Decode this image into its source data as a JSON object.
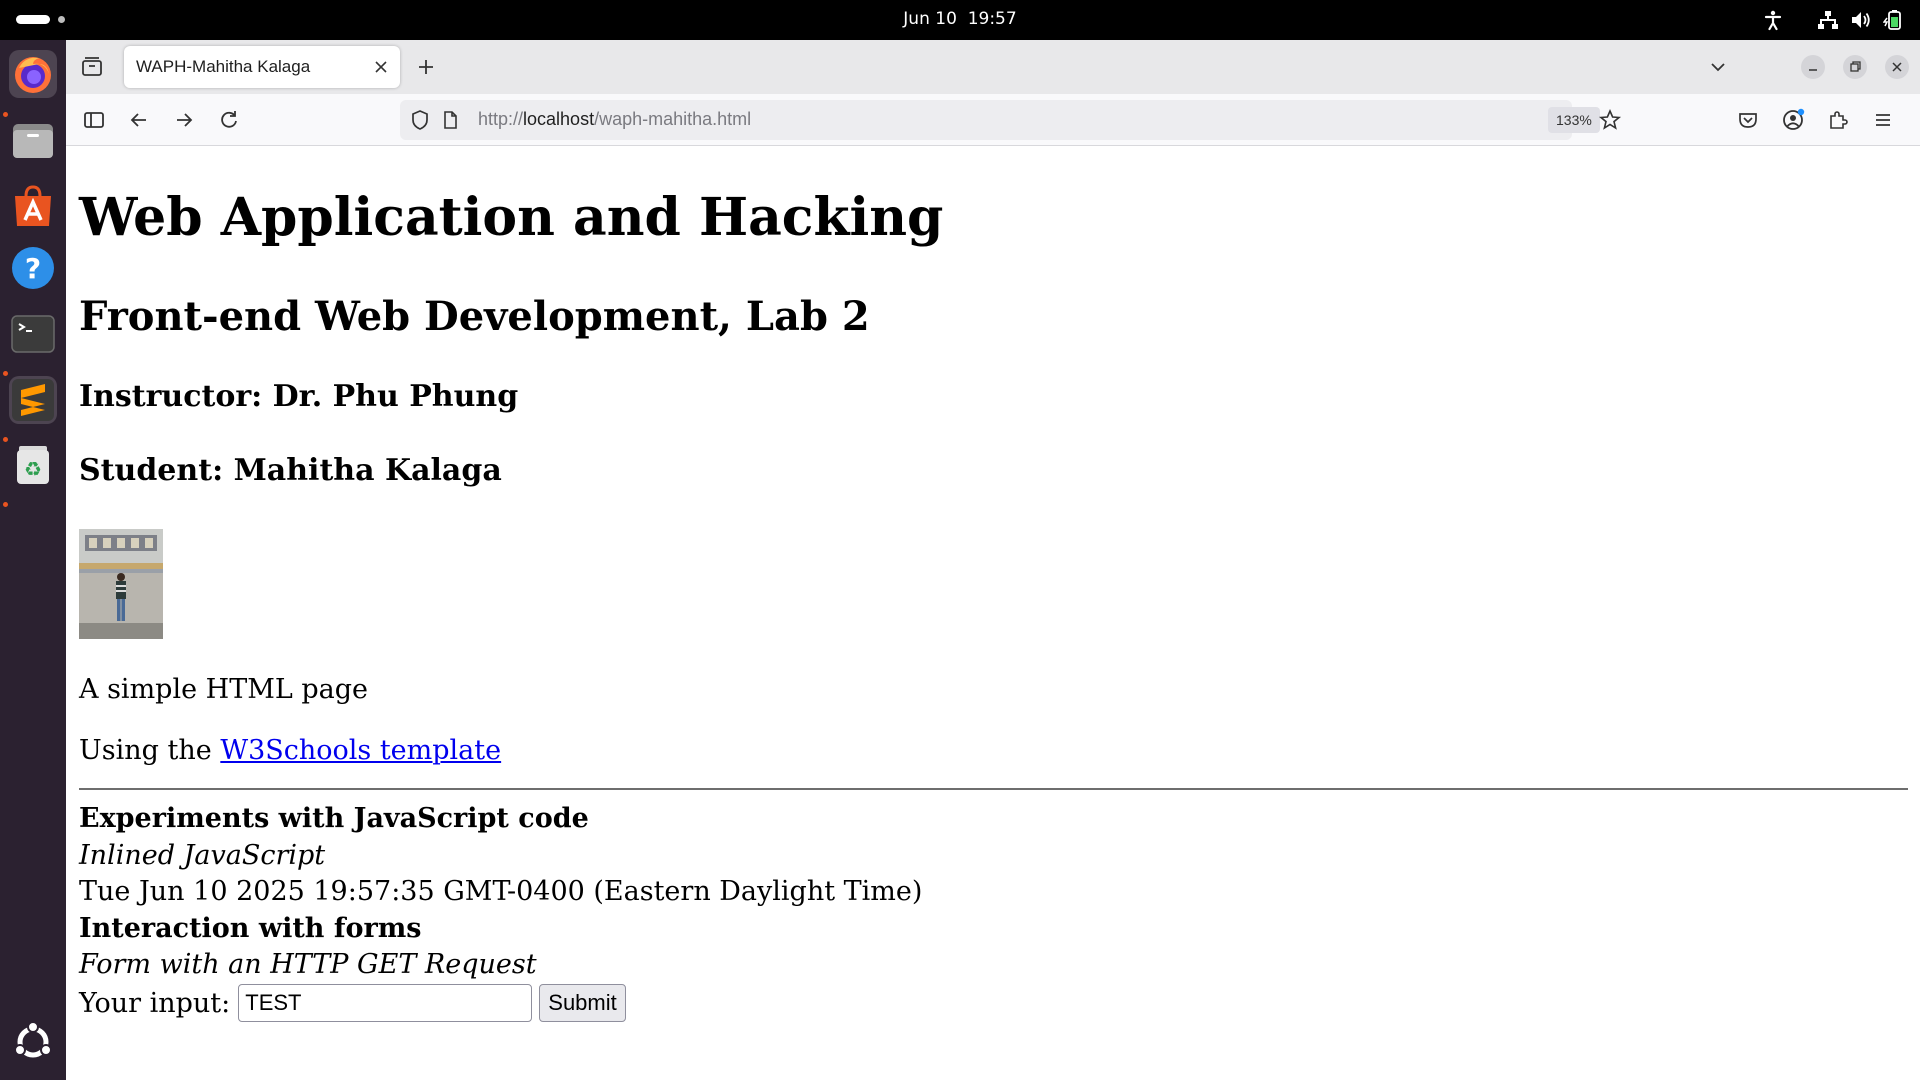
{
  "system": {
    "clock": "Jun 10  19:57",
    "tray_icons": [
      "accessibility-icon",
      "network-icon",
      "volume-icon",
      "battery-icon"
    ]
  },
  "dock": {
    "apps": [
      {
        "name": "Firefox",
        "icon": "firefox-icon",
        "running": true,
        "active": true
      },
      {
        "name": "Files",
        "icon": "files-icon",
        "running": false
      },
      {
        "name": "App Center",
        "icon": "app-center-icon",
        "running": false
      },
      {
        "name": "Help",
        "icon": "help-icon",
        "running": false
      },
      {
        "name": "Terminal",
        "icon": "terminal-icon",
        "running": true
      },
      {
        "name": "Sublime Text",
        "icon": "sublime-text-icon",
        "running": true
      },
      {
        "name": "Trash",
        "icon": "trash-icon",
        "running": true
      }
    ],
    "bottom_icon": "ubuntu-logo-icon"
  },
  "browser": {
    "tab_title": "WAPH-Mahitha Kalaga",
    "url_scheme": "http://",
    "url_host": "localhost",
    "url_path": "/waph-mahitha.html",
    "zoom": "133%",
    "colors": {
      "tabbar_bg": "#e8e8ea",
      "toolbar_bg": "#f9f9fb",
      "urlbar_bg": "#ededf0",
      "link": "#0000ee",
      "dock_bg": "#2b2130",
      "accent_orange": "#e95420"
    }
  },
  "page": {
    "h1": "Web Application and Hacking",
    "h2": "Front-end Web Development, Lab 2",
    "instructor": "Instructor: Dr. Phu Phung",
    "student": "Student: Mahitha Kalaga",
    "photo_icon": "student-photo",
    "p1": "A simple HTML page",
    "p2_prefix": "Using the ",
    "p2_link": "W3Schools template",
    "js_heading": "Experiments with JavaScript code",
    "js_inline": "Inlined JavaScript",
    "js_date": "Tue Jun 10 2025 19:57:35 GMT-0400 (Eastern Daylight Time)",
    "forms_heading": "Interaction with forms",
    "forms_sub": "Form with an HTTP GET Request",
    "input_label": "Your input:",
    "input_value": "TEST",
    "submit_label": "Submit"
  }
}
